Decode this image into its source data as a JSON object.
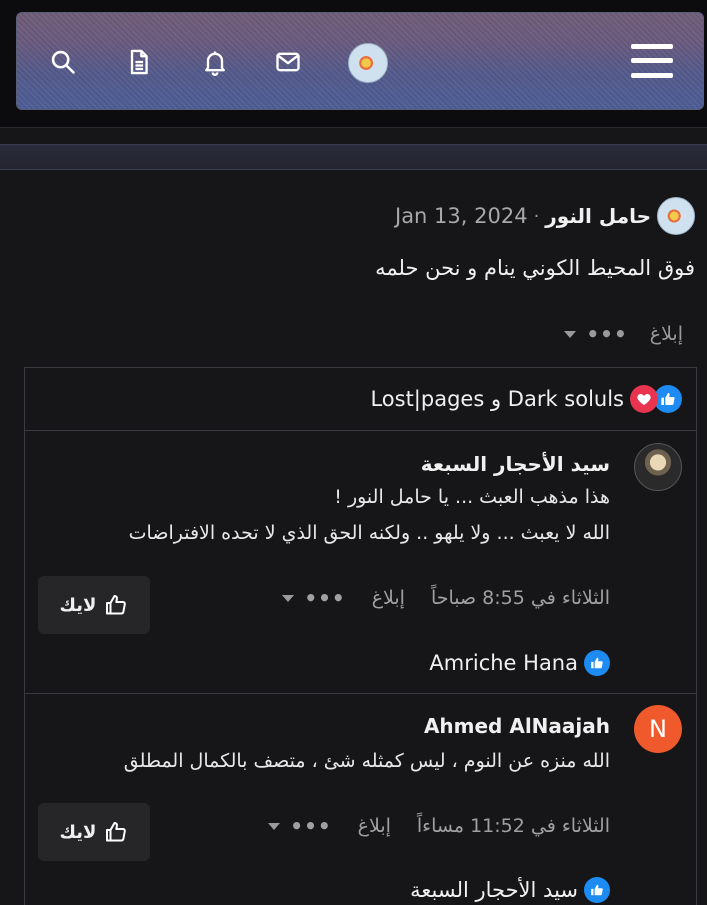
{
  "header": {
    "icons": [
      "search-icon",
      "document-icon",
      "bell-icon",
      "mail-icon",
      "avatar",
      "menu-icon"
    ]
  },
  "post": {
    "author": "حامل النور",
    "separator": "·",
    "date": "Jan 13, 2024",
    "body": "فوق المحيط الكوني ينام و نحن حلمه",
    "report_label": "إبلاغ",
    "more_label": "•••"
  },
  "reactions": {
    "text": "Dark soluls و Lost|pages"
  },
  "comments": [
    {
      "author": "سيد الأحجار السبعة",
      "lines": [
        "هذا مذهب العبث ... يا حامل النور !",
        "الله لا يعبث ... ولا يلهو .. ولكنه الحق الذي لا تحده الافتراضات"
      ],
      "time": "الثلاثاء في 8:55 صباحاً",
      "report_label": "إبلاغ",
      "more_label": "•••",
      "like_label": "لايك",
      "likers": "Amriche Hana"
    },
    {
      "author": "Ahmed AlNaajah",
      "avatar_letter": "N",
      "lines": [
        "الله منزه عن النوم ، ليس كمثله شئ ، متصف بالكمال المطلق"
      ],
      "time": "الثلاثاء في 11:52 مساءاً",
      "report_label": "إبلاغ",
      "more_label": "•••",
      "like_label": "لايك",
      "likers": "سيد الأحجار السبعة"
    }
  ],
  "colors": {
    "like_blue": "#1d8bf1",
    "love_red": "#e8344e",
    "letter_avatar": "#f0592b"
  }
}
